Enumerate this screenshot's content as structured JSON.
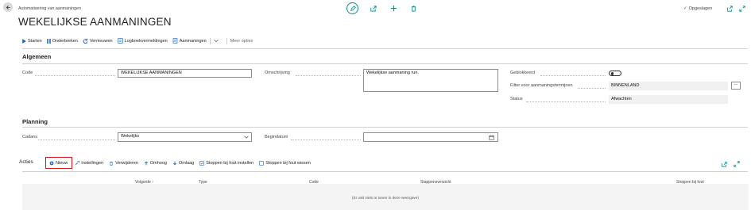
{
  "header": {
    "breadcrumb": "Automatisering van aanmaningen",
    "title": "WEKELIJKSE AANMANINGEN",
    "saved_label": "Opgeslagen"
  },
  "actionbar": {
    "items": [
      "Starten",
      "Onderbreken",
      "Vernieuwen",
      "Logboekvermeldingen",
      "Aanmaningen"
    ],
    "more_options": "Meer opties"
  },
  "general": {
    "section_title": "Algemeen",
    "code_label": "Code",
    "code_value": "WEKELIJKSE AANMANINGEN",
    "description_label": "Omschrijving",
    "description_value": "Wekelijkse aanmaning run.",
    "blocked_label": "Geblokkeerd",
    "filter_label": "Filter voor aanmaningstermijnen",
    "filter_value": "BINNENLAND",
    "status_label": "Status",
    "status_value": "Afwachten",
    "blocked_value": false
  },
  "planning": {
    "section_title": "Planning",
    "cadence_label": "Cadans",
    "cadence_value": "Wekelijks",
    "start_date_label": "Begindatum",
    "start_date_value": ""
  },
  "actions": {
    "section_title": "Acties",
    "toolbar": {
      "new": "Nieuw",
      "settings": "Instellingen",
      "delete": "Verwijderen",
      "move_up": "Omhoog",
      "move_down": "Omlaag",
      "stop_on_error_set": "Stoppen bij fout instellen",
      "stop_on_error_clear": "Stoppen bij fout wissen"
    },
    "columns": [
      "Volgorde",
      "Type",
      "Code",
      "Stappenoverzicht",
      "Stoppen bij fout"
    ],
    "sort_indicator": "↑",
    "empty_message": "(Er valt niets te tonen in deze weergave)"
  },
  "colors": {
    "accent": "#0b8a87",
    "highlight_border": "#d0151a",
    "link_blue": "#1f5fbf"
  }
}
